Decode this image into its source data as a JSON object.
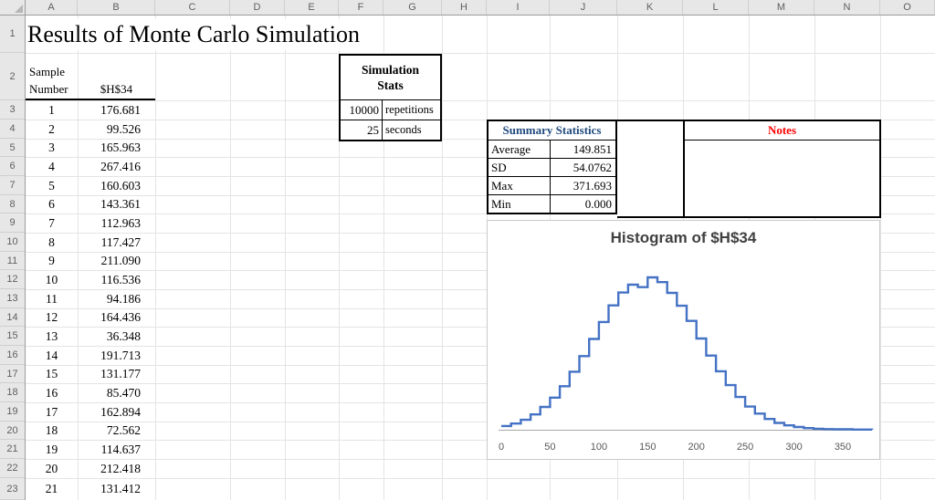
{
  "title": "Results of Monte Carlo Simulation",
  "grid": {
    "columns": [
      "A",
      "B",
      "C",
      "D",
      "E",
      "F",
      "G",
      "H",
      "I",
      "J",
      "K",
      "L",
      "M",
      "N",
      "O"
    ],
    "rows": [
      "1",
      "2",
      "3",
      "4",
      "5",
      "6",
      "7",
      "8",
      "9",
      "10",
      "11",
      "12",
      "13",
      "14",
      "15",
      "16",
      "17",
      "18",
      "19",
      "20",
      "21",
      "22",
      "23"
    ]
  },
  "sample_table": {
    "header_word1": "Sample",
    "header_word2": "Number",
    "value_header": "$H$34",
    "rows": [
      {
        "n": "1",
        "v": "176.681"
      },
      {
        "n": "2",
        "v": "99.526"
      },
      {
        "n": "3",
        "v": "165.963"
      },
      {
        "n": "4",
        "v": "267.416"
      },
      {
        "n": "5",
        "v": "160.603"
      },
      {
        "n": "6",
        "v": "143.361"
      },
      {
        "n": "7",
        "v": "112.963"
      },
      {
        "n": "8",
        "v": "117.427"
      },
      {
        "n": "9",
        "v": "211.090"
      },
      {
        "n": "10",
        "v": "116.536"
      },
      {
        "n": "11",
        "v": "94.186"
      },
      {
        "n": "12",
        "v": "164.436"
      },
      {
        "n": "13",
        "v": "36.348"
      },
      {
        "n": "14",
        "v": "191.713"
      },
      {
        "n": "15",
        "v": "131.177"
      },
      {
        "n": "16",
        "v": "85.470"
      },
      {
        "n": "17",
        "v": "162.894"
      },
      {
        "n": "18",
        "v": "72.562"
      },
      {
        "n": "19",
        "v": "114.637"
      },
      {
        "n": "20",
        "v": "212.418"
      },
      {
        "n": "21",
        "v": "131.412"
      }
    ]
  },
  "simulation_stats": {
    "title_line1": "Simulation",
    "title_line2": "Stats",
    "rows": [
      {
        "value": "10000",
        "label": "repetitions"
      },
      {
        "value": "25",
        "label": "seconds"
      }
    ]
  },
  "summary_statistics": {
    "title": "Summary Statistics",
    "title_color": "#1f497d",
    "rows": [
      {
        "label": "Average",
        "value": "149.851"
      },
      {
        "label": "SD",
        "value": "54.0762"
      },
      {
        "label": "Max",
        "value": "371.693"
      },
      {
        "label": "Min",
        "value": "0.000"
      }
    ]
  },
  "notes": {
    "title": "Notes",
    "title_color": "#ff0000"
  },
  "chart_data": {
    "type": "histogram",
    "title": "Histogram of $H$34",
    "title_color": "#404040",
    "line_color": "#4472c4",
    "axis_color": "#a6a6a6",
    "bin_start": 0,
    "bin_width": 10,
    "xlim": [
      0,
      380
    ],
    "x_ticks": [
      0,
      50,
      100,
      150,
      200,
      250,
      300,
      350
    ],
    "frequencies": [
      18,
      30,
      48,
      74,
      110,
      155,
      210,
      280,
      355,
      438,
      520,
      600,
      662,
      700,
      688,
      735,
      712,
      660,
      598,
      525,
      440,
      358,
      282,
      215,
      158,
      112,
      78,
      52,
      33,
      21,
      13,
      8,
      5,
      3,
      2,
      2,
      1,
      1
    ],
    "legend": null,
    "grid": false
  }
}
